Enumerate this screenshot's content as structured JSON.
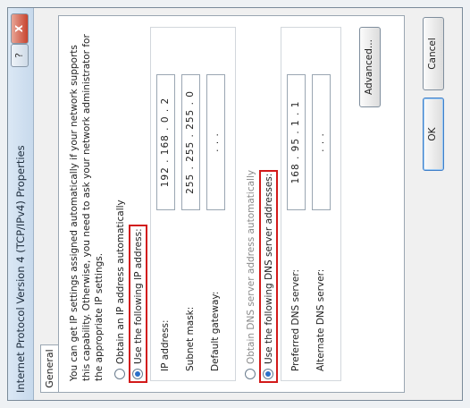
{
  "window": {
    "title": "Internet Protocol Version 4 (TCP/IPv4) Properties",
    "help_label": "?",
    "close_label": "X"
  },
  "tabs": [
    {
      "label": "General",
      "active": true
    }
  ],
  "general": {
    "description": "You can get IP settings assigned automatically if your network supports this capability. Otherwise, you need to ask your network administrator for the appropriate IP settings.",
    "obtain_ip_auto_label": "Obtain an IP address automatically",
    "use_following_ip_label": "Use the following IP address:",
    "ip_address_label": "IP address:",
    "ip_address_value": "192 . 168 . 0 . 2",
    "subnet_mask_label": "Subnet mask:",
    "subnet_mask_value": "255 . 255 . 255 . 0",
    "default_gateway_label": "Default gateway:",
    "default_gateway_value": ". . .",
    "obtain_dns_auto_label": "Obtain DNS server address automatically",
    "use_following_dns_label": "Use the following DNS server addresses:",
    "preferred_dns_label": "Preferred DNS server:",
    "preferred_dns_value": "168 . 95 . 1 . 1",
    "alternate_dns_label": "Alternate DNS server:",
    "alternate_dns_value": ". . .",
    "advanced_label": "Advanced..."
  },
  "footer": {
    "ok_label": "OK",
    "cancel_label": "Cancel"
  },
  "colors": {
    "highlight": "#d21a1a",
    "accent": "#2a6fc9"
  }
}
